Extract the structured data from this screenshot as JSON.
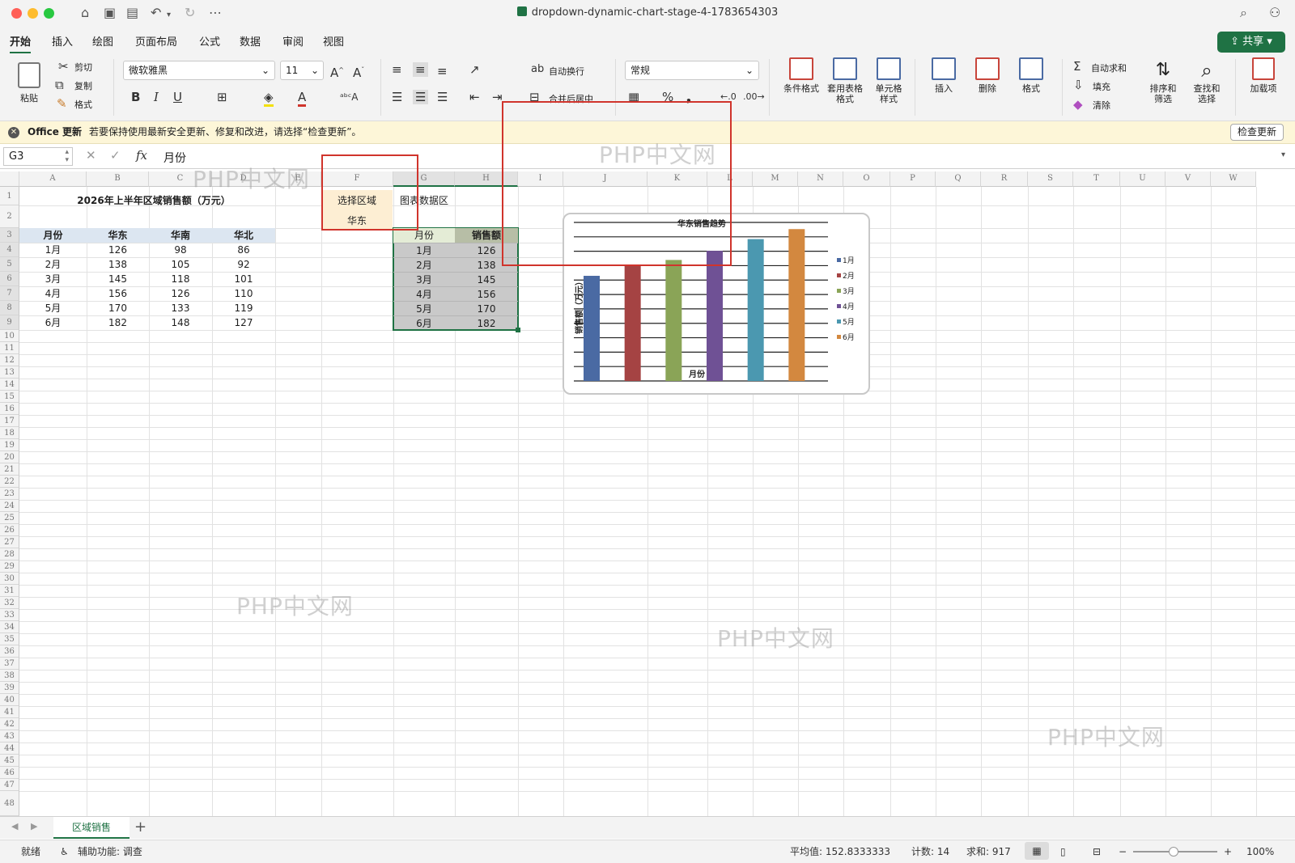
{
  "window": {
    "title": "dropdown-dynamic-chart-stage-4-1783654303"
  },
  "tabs": [
    "开始",
    "插入",
    "绘图",
    "页面布局",
    "公式",
    "数据",
    "审阅",
    "视图"
  ],
  "share_label": "共享",
  "ribbon": {
    "paste": "粘贴",
    "cut": "剪切",
    "copy": "复制",
    "format_painter": "格式",
    "font_name": "微软雅黑",
    "font_size": "11",
    "bold": "B",
    "italic": "I",
    "underline": "U",
    "wrap_text": "自动换行",
    "merge_center": "合并后居中",
    "number_format": "常规",
    "percent": "%",
    "comma": "❟",
    "conditional_format": "条件格式",
    "format_table_1": "套用表格",
    "format_table_2": "格式",
    "cell_style_1": "单元格",
    "cell_style_2": "样式",
    "insert": "插入",
    "delete": "删除",
    "format": "格式",
    "autosum": "自动求和",
    "fill": "填充",
    "clear": "清除",
    "sort_1": "排序和",
    "sort_2": "筛选",
    "find_1": "查找和",
    "find_2": "选择",
    "addins": "加载项"
  },
  "notification": {
    "title": "Office 更新",
    "message": "若要保持使用最新安全更新、修复和改进，请选择“检查更新”。",
    "button": "检查更新"
  },
  "formula_bar": {
    "name_box": "G3",
    "fx": "fx",
    "value": "月份"
  },
  "columns": [
    "A",
    "B",
    "C",
    "D",
    "E",
    "F",
    "G",
    "H",
    "I",
    "J",
    "K",
    "L",
    "M",
    "N",
    "O",
    "P",
    "Q",
    "R",
    "S",
    "T",
    "U",
    "V",
    "W"
  ],
  "rows": [
    "1",
    "2",
    "3",
    "4",
    "5",
    "6",
    "7",
    "8",
    "9",
    "10",
    "11",
    "12",
    "13",
    "14",
    "15",
    "16",
    "17",
    "18",
    "19",
    "20",
    "21",
    "22",
    "23",
    "24",
    "25",
    "26",
    "27",
    "28",
    "29",
    "30",
    "31",
    "32",
    "33",
    "34",
    "35",
    "36",
    "37",
    "38",
    "39",
    "40",
    "41",
    "42",
    "43",
    "44",
    "45",
    "46",
    "47",
    "48"
  ],
  "sheet": {
    "title": "2026年上半年区域销售额（万元）",
    "headers": [
      "月份",
      "华东",
      "华南",
      "华北"
    ],
    "data": [
      [
        "1月",
        "126",
        "98",
        "86"
      ],
      [
        "2月",
        "138",
        "105",
        "92"
      ],
      [
        "3月",
        "145",
        "118",
        "101"
      ],
      [
        "4月",
        "156",
        "126",
        "110"
      ],
      [
        "5月",
        "170",
        "133",
        "119"
      ],
      [
        "6月",
        "182",
        "148",
        "127"
      ]
    ],
    "select_label": "选择区域",
    "select_value": "华东",
    "chart_area_label": "图表数据区",
    "chart_headers": [
      "月份",
      "销售额"
    ],
    "chart_rows": [
      [
        "1月",
        "126"
      ],
      [
        "2月",
        "138"
      ],
      [
        "3月",
        "145"
      ],
      [
        "4月",
        "156"
      ],
      [
        "5月",
        "170"
      ],
      [
        "6月",
        "182"
      ]
    ]
  },
  "chart_data": {
    "type": "bar",
    "title": "华东销售趋势",
    "xlabel": "月份",
    "ylabel": "销售额（万元）",
    "categories": [
      "1月",
      "2月",
      "3月",
      "4月",
      "5月",
      "6月"
    ],
    "values": [
      126,
      138,
      145,
      156,
      170,
      182
    ],
    "colors": [
      "#4a6aa3",
      "#a54343",
      "#8aa457",
      "#6f5195",
      "#4b98b0",
      "#d3883f"
    ],
    "ylim": [
      0,
      190
    ],
    "grid": true,
    "legend": "right"
  },
  "sheet_tab": "区域销售",
  "status": {
    "ready": "就绪",
    "accessibility": "辅助功能: 调查",
    "average": "平均值: 152.8333333",
    "count": "计数: 14",
    "sum": "求和: 917",
    "zoom": "100%"
  },
  "watermark": "PHP中文网"
}
